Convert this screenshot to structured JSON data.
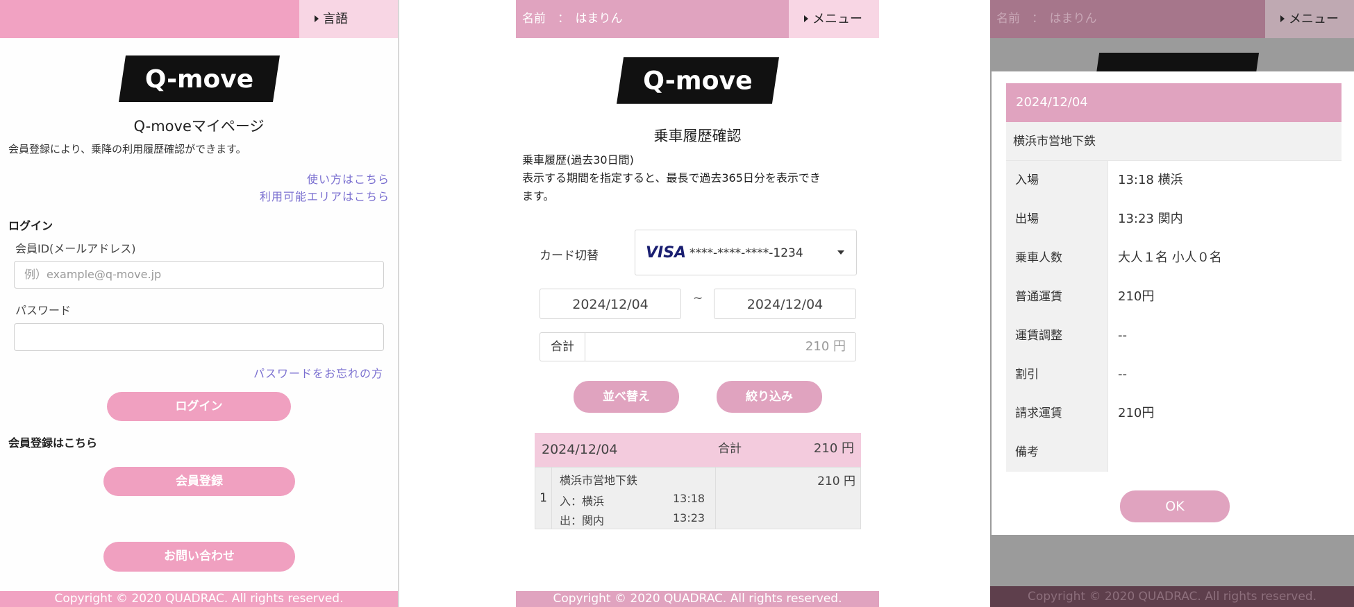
{
  "colors": {
    "accent_pink": "#f0a0c0",
    "panel2_bar": "#e0a3bf",
    "panel3_bar_dim": "#a6768b",
    "link_purple": "#7a6fd0",
    "logo_black": "#111111"
  },
  "login_screen": {
    "lang_label": "言語",
    "logo_text": "Q-move",
    "page_title": "Q-moveマイページ",
    "intro": "会員登録により、乗降の利用履歴確認ができます。",
    "link_howto": "使い方はこちら",
    "link_area": "利用可能エリアはこちら",
    "login_heading": "ログイン",
    "id_label": "会員ID(メールアドレス)",
    "id_placeholder": "例）example@q-move.jp",
    "password_label": "パスワード",
    "password_value": "",
    "forgot_link": "パスワードをお忘れの方",
    "login_button": "ログイン",
    "register_heading": "会員登録はこちら",
    "register_button": "会員登録",
    "contact_button": "お問い合わせ",
    "footer": "Copyright © 2020 QUADRAC. All rights reserved."
  },
  "history_screen": {
    "user_label": "名前　：　はまりん",
    "menu_label": "メニュー",
    "logo_text": "Q-move",
    "title": "乗車履歴確認",
    "desc_line1": "乗車履歴(過去30日間)",
    "desc_line2": "表示する期間を指定すると、最長で過去365日分を表示でき",
    "desc_line3": "ます。",
    "card_label": "カード切替",
    "card_brand": "VISA",
    "card_number": "****-****-****-1234",
    "date_from": "2024/12/04",
    "date_sep": "~",
    "date_to": "2024/12/04",
    "total_label": "合計",
    "total_value": "210 円",
    "sort_button": "並べ替え",
    "filter_button": "絞り込み",
    "group": {
      "date": "2024/12/04",
      "total_label": "合計",
      "total_value": "210 円",
      "rows": [
        {
          "index": "1",
          "line": "横浜市営地下鉄",
          "in_label": "入：横浜",
          "in_time": "13:18",
          "out_label": "出：関内",
          "out_time": "13:23",
          "fare": "210 円"
        }
      ]
    },
    "footer": "Copyright © 2020 QUADRAC. All rights reserved."
  },
  "detail_screen": {
    "user_label": "名前　：　はまりん",
    "menu_label": "メニュー",
    "modal": {
      "date": "2024/12/04",
      "line": "横浜市営地下鉄",
      "rows": [
        {
          "key": "入場",
          "value": "13:18 横浜"
        },
        {
          "key": "出場",
          "value": "13:23 関内"
        },
        {
          "key": "乗車人数",
          "value": "大人１名  小人０名"
        },
        {
          "key": "普通運賃",
          "value": " 210円"
        },
        {
          "key": "運賃調整",
          "value": "--"
        },
        {
          "key": "割引",
          "value": "--"
        },
        {
          "key": "請求運賃",
          "value": " 210円"
        },
        {
          "key": "備考",
          "value": ""
        }
      ],
      "ok_button": "OK"
    },
    "footer": "Copyright © 2020 QUADRAC. All rights reserved."
  }
}
